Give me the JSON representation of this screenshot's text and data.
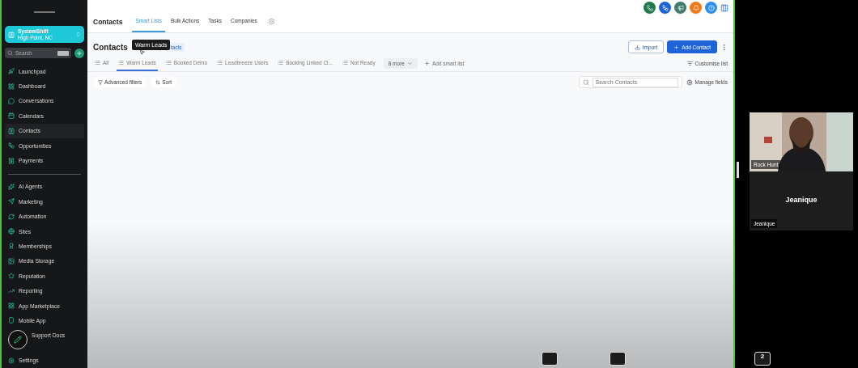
{
  "sidebar": {
    "account": {
      "name": "SystemShift",
      "location": "High Point, NC"
    },
    "search": {
      "placeholder": "Search"
    },
    "nav_primary": [
      {
        "label": "Launchpad",
        "selected": false
      },
      {
        "label": "Dashboard",
        "selected": false
      },
      {
        "label": "Conversations",
        "selected": false
      },
      {
        "label": "Calendars",
        "selected": false
      },
      {
        "label": "Contacts",
        "selected": true
      },
      {
        "label": "Opportunities",
        "selected": false
      },
      {
        "label": "Payments",
        "selected": false
      }
    ],
    "nav_secondary": [
      {
        "label": "AI Agents",
        "selected": false
      },
      {
        "label": "Marketing",
        "selected": false
      },
      {
        "label": "Automation",
        "selected": false
      },
      {
        "label": "Sites",
        "selected": false
      },
      {
        "label": "Memberships",
        "selected": false
      },
      {
        "label": "Media Storage",
        "selected": false
      },
      {
        "label": "Reputation",
        "selected": false
      },
      {
        "label": "Reporting",
        "selected": false
      },
      {
        "label": "App Marketplace",
        "selected": false
      },
      {
        "label": "Mobile App",
        "selected": false
      },
      {
        "label": "Support Docs",
        "selected": false
      }
    ],
    "settings": "Settings"
  },
  "topbar": {
    "title": "Contacts",
    "tabs": [
      {
        "label": "Smart Lists",
        "selected": true
      },
      {
        "label": "Bulk Actions",
        "selected": false
      },
      {
        "label": "Tasks",
        "selected": false
      },
      {
        "label": "Companies",
        "selected": false
      }
    ],
    "icons": [
      {
        "color": "#1e7a4a"
      },
      {
        "color": "#1f63d8"
      },
      {
        "color": "#3f7a6a"
      },
      {
        "color": "#f07a1a"
      },
      {
        "color": "#2a8ff0"
      }
    ]
  },
  "header": {
    "title": "Contacts",
    "link": "tacts",
    "tooltip": "Warm Leads",
    "import": "Import",
    "add": "Add Contact"
  },
  "smart_lists": [
    {
      "label": "All",
      "selected": false
    },
    {
      "label": "Warm Leads",
      "selected": true
    },
    {
      "label": "Booked Demo",
      "selected": false
    },
    {
      "label": "Leadbreeze Users",
      "selected": false
    },
    {
      "label": "Booking Linked Cl...",
      "selected": false
    },
    {
      "label": "Not Ready",
      "selected": false
    }
  ],
  "more": "8 more",
  "add_list": "Add smart list",
  "customise": "Customise list",
  "filters": {
    "advanced": "Advanced filters",
    "sort": "Sort",
    "search_placeholder": "Search Contacts",
    "manage": "Manage fields"
  },
  "call": {
    "tiles": [
      {
        "kind": "video",
        "name": "Rock Hunt"
      },
      {
        "kind": "avatar",
        "name": "Jeanique",
        "label": "Jeanique"
      }
    ],
    "chat_badges": [
      {
        "kind": "plain"
      },
      {
        "kind": "plain"
      },
      {
        "kind": "count",
        "count": "2"
      }
    ]
  }
}
